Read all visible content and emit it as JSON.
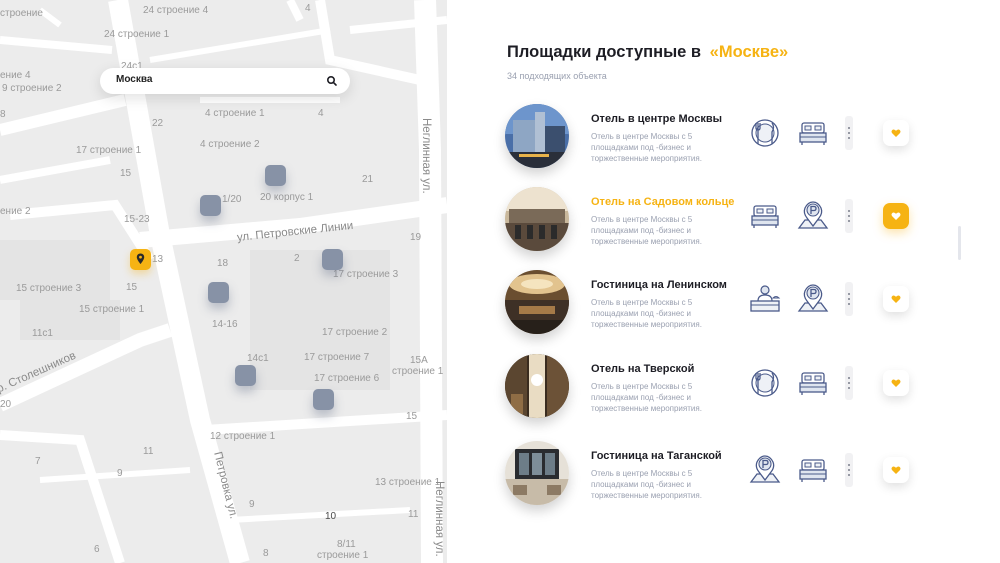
{
  "map": {
    "search": {
      "value": "Москва",
      "placeholder": ""
    },
    "labels": {
      "l_stroenie_grey": "строение",
      "l_24s4": "24 строение 4",
      "l_24s1": "24 строение 1",
      "l_24c1": "24с1",
      "l_4": "4",
      "l_9s2": "9 строение 2",
      "l_e4": "ение 4",
      "l_8": "8",
      "l_4s1": "4 строение 1",
      "l_4b": "4",
      "l_22": "22",
      "l_4s2": "4 строение 2",
      "l_17s1": "17 строение 1",
      "l_15": "15",
      "l_21": "21",
      "l_20k1": "20 корпус 1",
      "l_1_20": "1/20",
      "l_e2": "ение 2",
      "l_15_23": "15-23",
      "l_19": "19",
      "l_13": "13",
      "l_18": "18",
      "l_2": "2",
      "l_17s3": "17 строение 3",
      "l_15s3": "15 строение 3",
      "l_15b": "15",
      "l_15s1": "15 строение 1",
      "l_14_16": "14-16",
      "l_11c1": "11с1",
      "l_17s2": "17 строение 2",
      "l_14c1": "14с1",
      "l_17s7": "17 строение 7",
      "l_15a": "15А",
      "l_stroenie1": "строение 1",
      "l_17s6": "17 строение 6",
      "l_20": "20",
      "l_15c": "15",
      "l_12s1": "12 строение 1",
      "l_11": "11",
      "l_7": "7",
      "l_9": "9",
      "l_13s1": "13 строение 1",
      "l_9b": "9",
      "l_10": "10",
      "l_11b": "11",
      "l_6": "6",
      "l_8b": "8",
      "l_8_11": "8/11",
      "l_stroenie1b": "строение 1"
    },
    "streets": {
      "neglinnaya_top": "Неглинная ул.",
      "petrovskie": "ул. Петровские Линии",
      "stoleshnikov": "пер. Столешников",
      "petrovka": "Петровка ул.",
      "neglinnaya_bottom": "Неглинная ул."
    }
  },
  "panel": {
    "title": "Площадки доступные в",
    "title_city": "«Москве»",
    "subtitle": "34 подходящих объекта",
    "venues": [
      {
        "name": "Отель в центре Москвы",
        "description": "Отель в центре Москвы с 5 площадками под -бизнес и торжественные мероприятия.",
        "amenities": [
          "dining-icon",
          "bed-icon"
        ],
        "favorite": false,
        "highlighted": false
      },
      {
        "name": "Отель на Садовом кольце",
        "description": "Отель в центре Москвы с 5 площадками под -бизнес и торжественные мероприятия.",
        "amenities": [
          "bed-icon",
          "parking-icon"
        ],
        "favorite": true,
        "highlighted": true
      },
      {
        "name": "Гостиница на Ленинском",
        "description": "Отель в центре Москвы с 5 площадками под -бизнес и торжественные мероприятия.",
        "amenities": [
          "reception-icon",
          "parking-icon"
        ],
        "favorite": false,
        "highlighted": false
      },
      {
        "name": "Отель на Тверской",
        "description": "Отель в центре Москвы с 5 площадками под -бизнес и торжественные мероприятия.",
        "amenities": [
          "dining-icon",
          "bed-icon"
        ],
        "favorite": false,
        "highlighted": false
      },
      {
        "name": "Гостиница на Таганской",
        "description": "Отель в центре Москвы с 5 площадками под -бизнес и торжественные мероприятия.",
        "amenities": [
          "parking-icon",
          "bed-icon"
        ],
        "favorite": false,
        "highlighted": false
      }
    ]
  },
  "colors": {
    "accent": "#f6b313",
    "marker": "#8792a6",
    "icon_stroke": "#4a5a8a",
    "map_bg": "#ececec"
  }
}
